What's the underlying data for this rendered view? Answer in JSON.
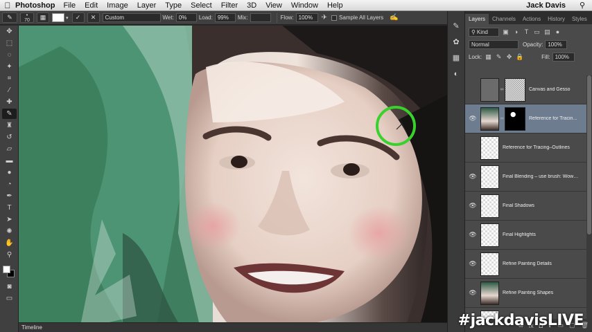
{
  "menubar": {
    "app_name": "Photoshop",
    "menus": [
      "File",
      "Edit",
      "Image",
      "Layer",
      "Type",
      "Select",
      "Filter",
      "3D",
      "View",
      "Window",
      "Help"
    ],
    "user": "Jack Davis"
  },
  "options": {
    "brush_size": "70",
    "preset": "Custom",
    "wet_label": "Wet:",
    "wet_value": "0%",
    "load_label": "Load:",
    "load_value": "99%",
    "mix_label": "Mix:",
    "flow_label": "Flow:",
    "flow_value": "100%",
    "sample_all_label": "Sample All Layers"
  },
  "layers_panel": {
    "tabs": [
      "Layers",
      "Channels",
      "Actions",
      "History",
      "Styles"
    ],
    "filter_kind": "Kind",
    "blend_mode": "Normal",
    "opacity_label": "Opacity:",
    "opacity_value": "100%",
    "lock_label": "Lock:",
    "fill_label": "Fill:",
    "fill_value": "100%",
    "layers": [
      {
        "name": "Canvas and Gesso",
        "visible": false,
        "selected": false
      },
      {
        "name": "Reference for Tracin...",
        "visible": true,
        "selected": true
      },
      {
        "name": "Reference for Tracing–Outlines",
        "visible": false,
        "selected": false
      },
      {
        "name": "Final Blending – use brush: Wow–...",
        "visible": true,
        "selected": false
      },
      {
        "name": "Final Shadows",
        "visible": true,
        "selected": false
      },
      {
        "name": "Final Highlights",
        "visible": true,
        "selected": false
      },
      {
        "name": "Refine Painting Details",
        "visible": true,
        "selected": false
      },
      {
        "name": "Refine Painting Shapes",
        "visible": true,
        "selected": false
      }
    ]
  },
  "timeline": {
    "label": "Timeline"
  },
  "watermark": "#jackdavisLIVE",
  "colors": {
    "highlight_ring": "#39d12b",
    "selected_layer": "#6d7c8f",
    "panel_bg": "#4a4a4a"
  },
  "icons": {
    "apple": "apple-icon",
    "search": "spotlight-icon",
    "tools": [
      "move-icon",
      "marquee-icon",
      "lasso-icon",
      "quick-select-icon",
      "crop-icon",
      "eyedropper-icon",
      "healing-icon",
      "mixer-brush-icon",
      "stamp-icon",
      "history-brush-icon",
      "eraser-icon",
      "gradient-icon",
      "blur-icon",
      "dodge-icon",
      "pen-icon",
      "type-icon",
      "path-select-icon",
      "shape-icon",
      "hand-icon",
      "zoom-icon"
    ]
  }
}
